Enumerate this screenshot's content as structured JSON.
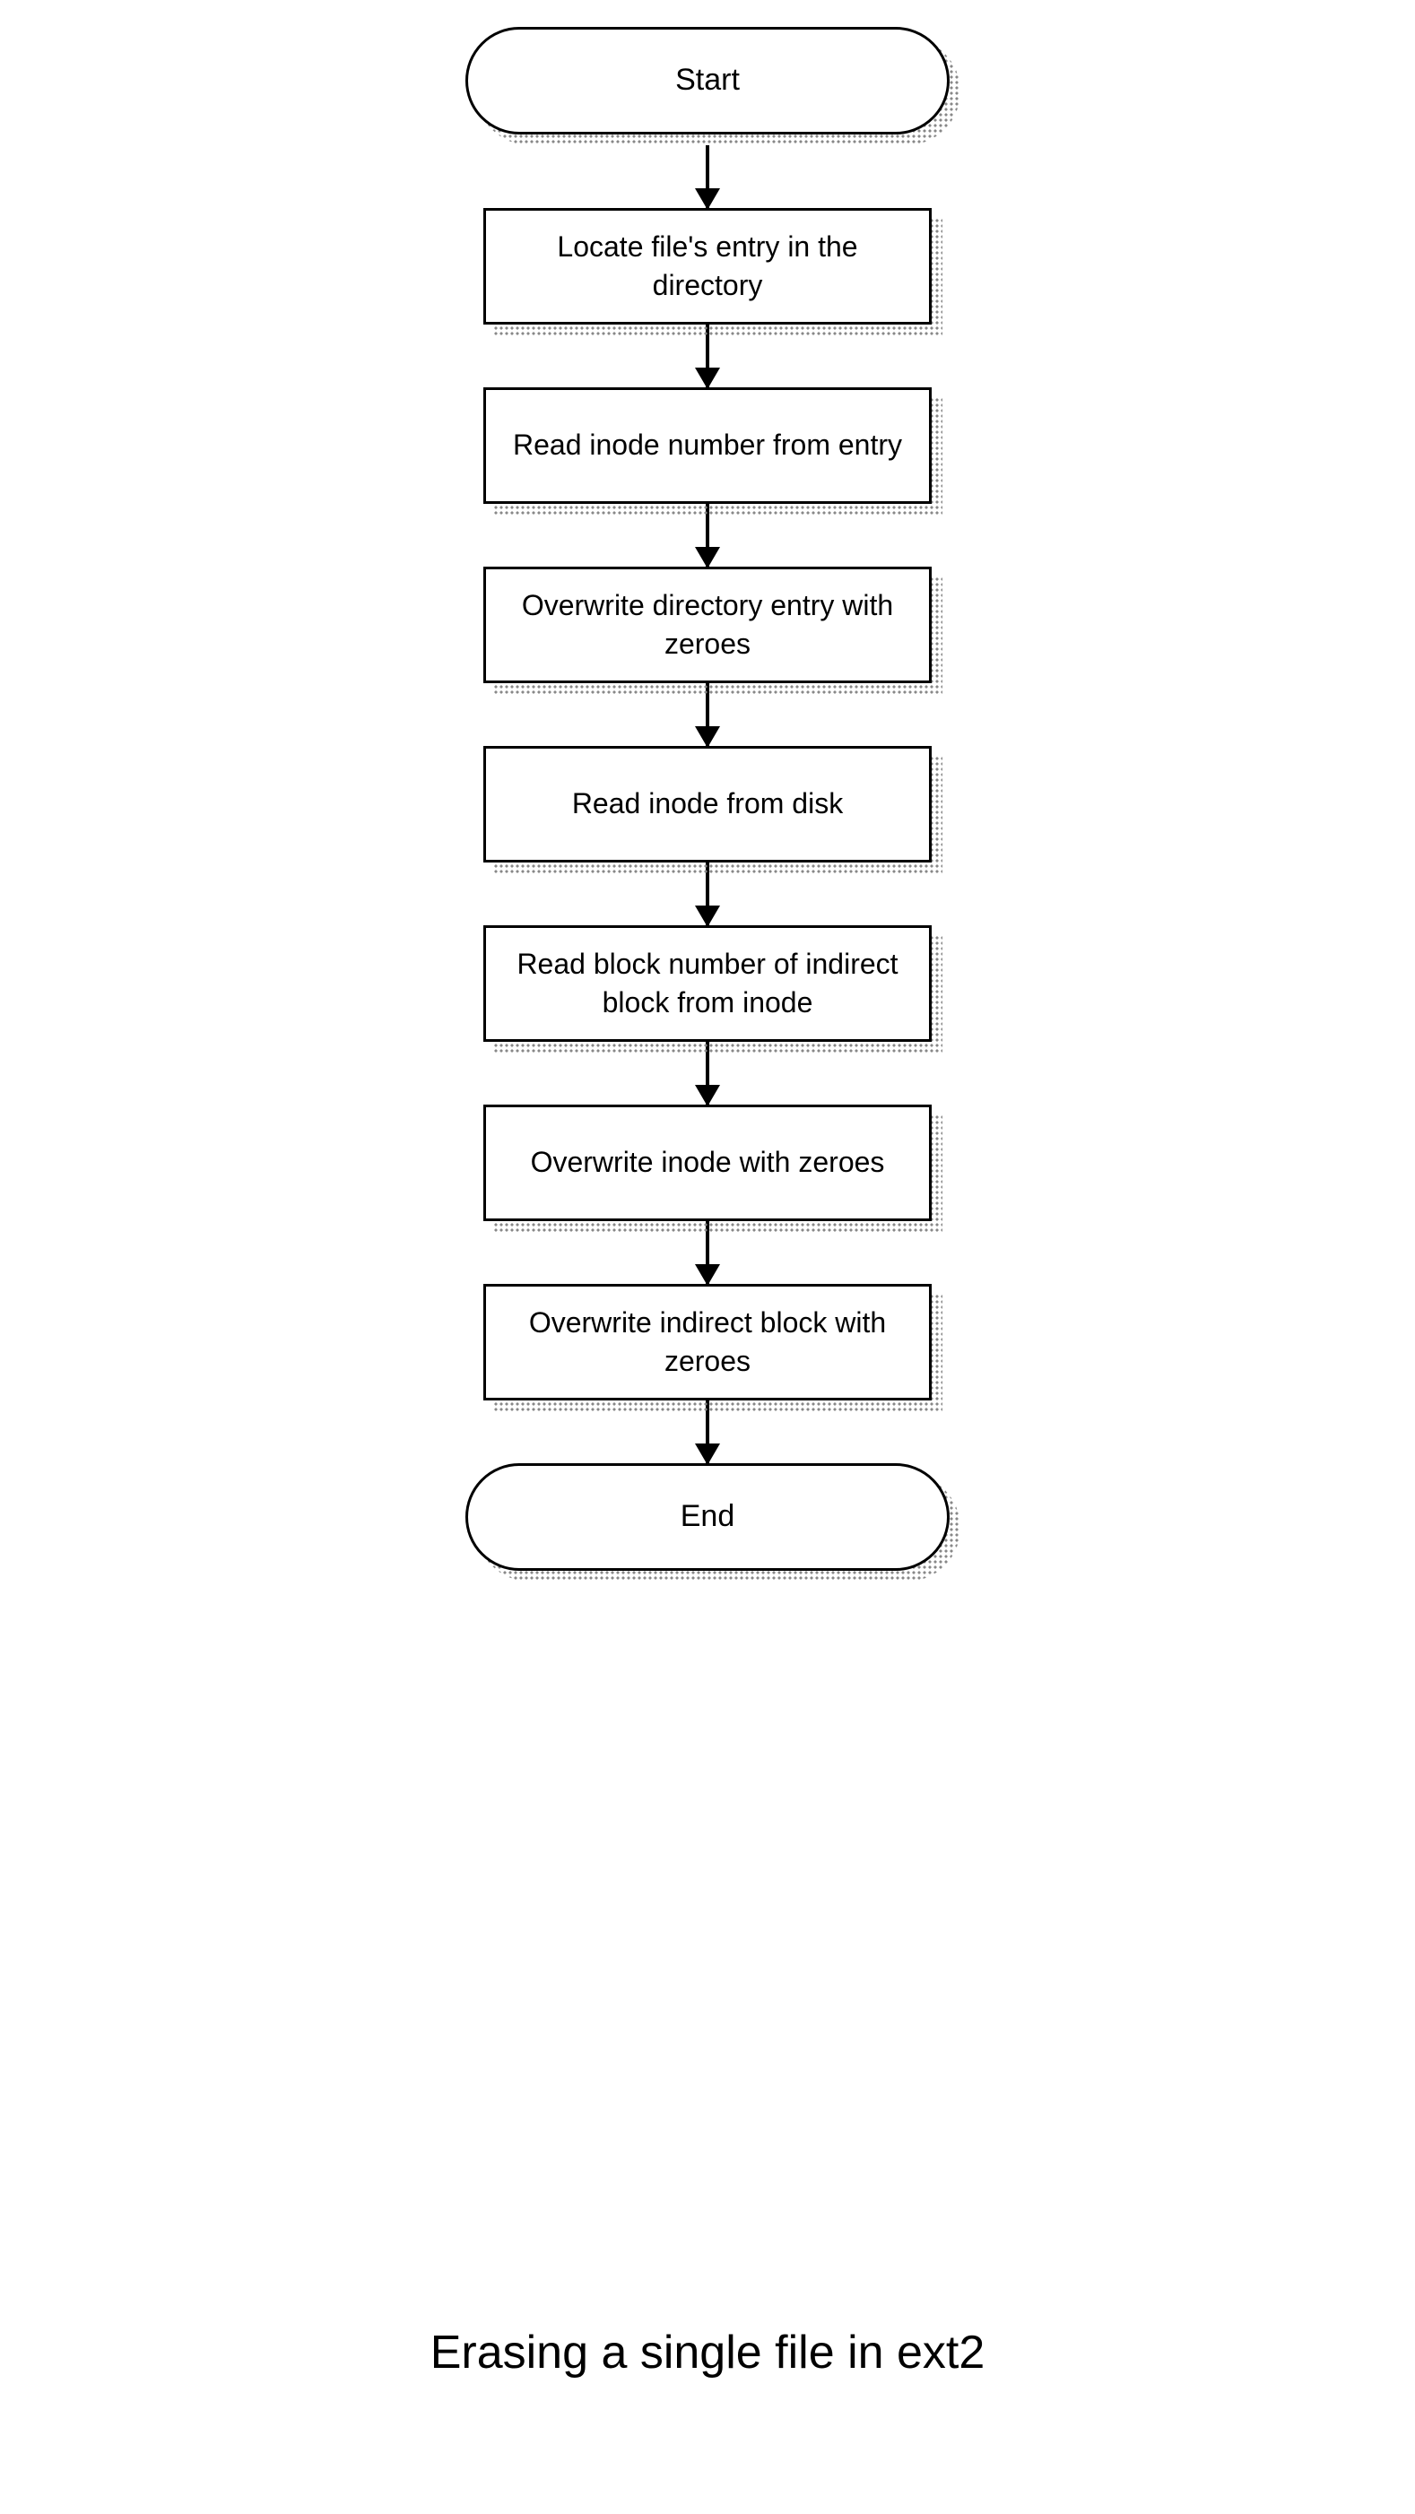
{
  "flowchart": {
    "nodes": [
      {
        "type": "terminator",
        "label": "Start"
      },
      {
        "type": "process",
        "label": "Locate file's entry in the directory"
      },
      {
        "type": "process",
        "label": "Read inode number from entry"
      },
      {
        "type": "process",
        "label": "Overwrite directory entry with zeroes"
      },
      {
        "type": "process",
        "label": "Read inode from disk"
      },
      {
        "type": "process",
        "label": "Read block number of indirect block from inode"
      },
      {
        "type": "process",
        "label": "Overwrite inode with zeroes"
      },
      {
        "type": "process",
        "label": "Overwrite indirect block with zeroes"
      },
      {
        "type": "terminator",
        "label": "End"
      }
    ],
    "caption": "Erasing a single file in ext2"
  }
}
